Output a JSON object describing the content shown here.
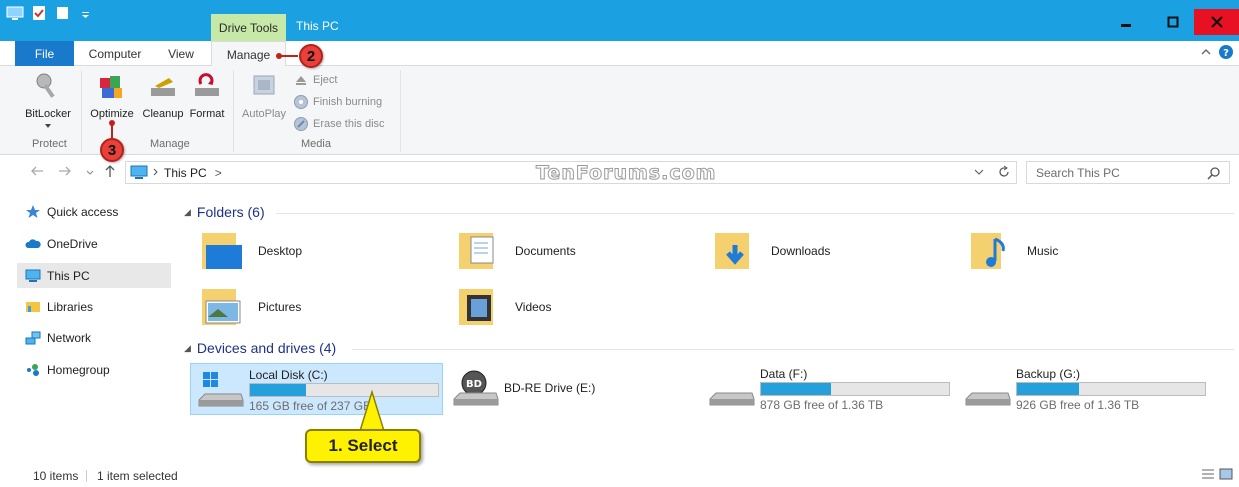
{
  "window": {
    "title": "This PC",
    "context_tab": "Drive Tools",
    "colors": {
      "titlebar": "#1ba1e2",
      "context": "#c7e9a7",
      "close": "#e81123",
      "file_tab": "#1979ca",
      "drive_fill": "#26a0da"
    }
  },
  "tabs": {
    "file": "File",
    "computer": "Computer",
    "view": "View",
    "manage": "Manage"
  },
  "ribbon": {
    "bitlocker": "BitLocker",
    "optimize": "Optimize",
    "cleanup": "Cleanup",
    "format": "Format",
    "autoplay": "AutoPlay",
    "eject": "Eject",
    "finish_burning": "Finish burning",
    "erase_disc": "Erase this disc",
    "groups": {
      "protect": "Protect",
      "manage": "Manage",
      "media": "Media"
    }
  },
  "address": {
    "path": "This PC",
    "separator": ">",
    "watermark": "TenForums.com",
    "search_placeholder": "Search This PC"
  },
  "sidebar": {
    "items": [
      {
        "label": "Quick access",
        "icon": "star-icon"
      },
      {
        "label": "OneDrive",
        "icon": "cloud-icon"
      },
      {
        "label": "This PC",
        "icon": "computer-icon"
      },
      {
        "label": "Libraries",
        "icon": "library-icon"
      },
      {
        "label": "Network",
        "icon": "network-icon"
      },
      {
        "label": "Homegroup",
        "icon": "homegroup-icon"
      }
    ]
  },
  "folders": {
    "header": "Folders (6)",
    "items": [
      "Desktop",
      "Documents",
      "Downloads",
      "Music",
      "Pictures",
      "Videos"
    ]
  },
  "drives": {
    "header": "Devices and drives (4)",
    "items": [
      {
        "name": "Local Disk (C:)",
        "free": "165 GB free of 237 GB",
        "used_fraction": 0.3
      },
      {
        "name": "BD-RE Drive (E:)"
      },
      {
        "name": "Data (F:)",
        "free": "878 GB free of 1.36 TB",
        "used_fraction": 0.37
      },
      {
        "name": "Backup (G:)",
        "free": "926 GB free of 1.36 TB",
        "used_fraction": 0.33
      }
    ]
  },
  "status": {
    "items": "10 items",
    "selected": "1 item selected"
  },
  "annotations": {
    "step2": "2",
    "step3": "3",
    "step1": "1. Select"
  }
}
